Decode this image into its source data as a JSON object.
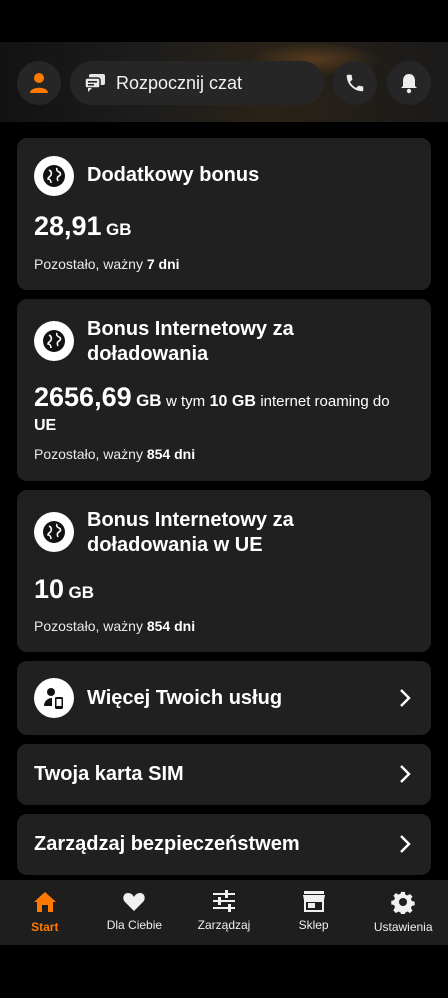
{
  "header": {
    "chat_label": "Rozpocznij czat"
  },
  "colors": {
    "accent": "#ff7900",
    "card": "#202020",
    "background": "#000000"
  },
  "cards": [
    {
      "title": "Dodatkowy bonus",
      "amount": "28,91",
      "unit": "GB",
      "validity_prefix": "Pozostało, ważny",
      "validity_value": "7 dni"
    },
    {
      "title": "Bonus Internetowy za doładowania",
      "amount": "2656,69",
      "unit": "GB",
      "extra_prefix": "w tym",
      "extra_amount": "10 GB",
      "extra_suffix": "internet roaming do",
      "extra_tail": "UE",
      "validity_prefix": "Pozostało, ważny",
      "validity_value": "854 dni"
    },
    {
      "title": "Bonus Internetowy za doładowania w UE",
      "amount": "10",
      "unit": "GB",
      "validity_prefix": "Pozostało, ważny",
      "validity_value": "854 dni"
    }
  ],
  "links": [
    {
      "label": "Więcej Twoich usług",
      "icon": "person-phone-icon"
    },
    {
      "label": "Twoja karta SIM"
    },
    {
      "label": "Zarządzaj bezpieczeństwem"
    }
  ],
  "nav": [
    {
      "label": "Start",
      "icon": "home-icon",
      "active": true
    },
    {
      "label": "Dla Ciebie",
      "icon": "heart-icon"
    },
    {
      "label": "Zarządzaj",
      "icon": "sliders-icon"
    },
    {
      "label": "Sklep",
      "icon": "shop-icon"
    },
    {
      "label": "Ustawienia",
      "icon": "gear-icon"
    }
  ]
}
